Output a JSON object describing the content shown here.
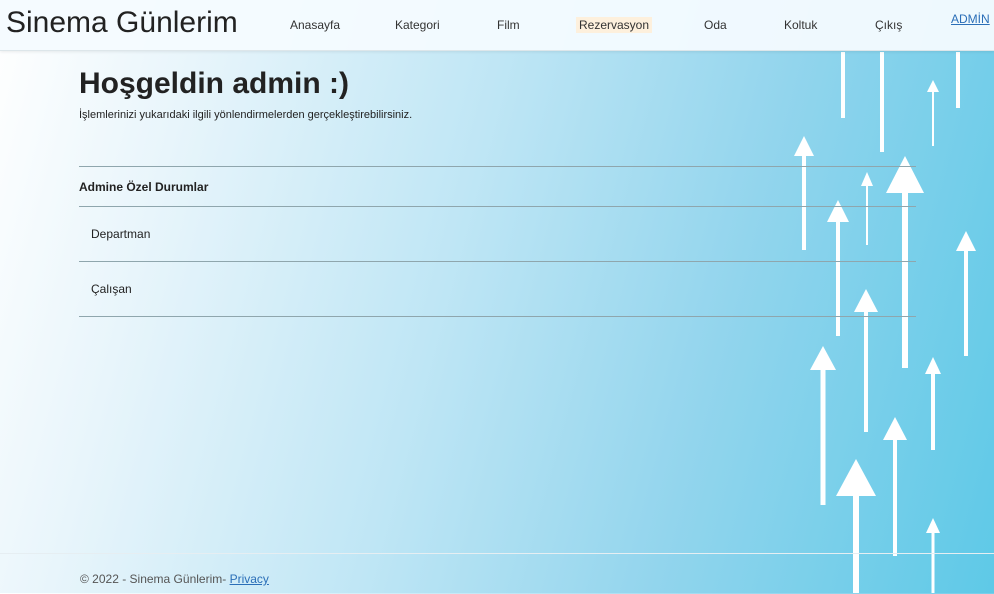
{
  "brand": "Sinema Günlerim",
  "nav": {
    "items": [
      "Anasayfa",
      "Kategori",
      "Film",
      "Rezervasyon",
      "Oda",
      "Koltuk",
      "Çıkış"
    ],
    "active": "Rezervasyon",
    "user": "ADMİN"
  },
  "main": {
    "title": "Hoşgeldin admin :)",
    "subtitle": "İşlemlerinizi yukarıdaki ilgili yönlendirmelerden gerçekleştirebilirsiniz.",
    "section_header": "Admine Özel Durumlar",
    "items": [
      "Departman",
      "Çalışan"
    ]
  },
  "footer": {
    "copyright": "© 2022 - Sinema Günlerim-",
    "privacy": "Privacy"
  },
  "colors": {
    "gradient_end": "#5ec9e7",
    "link": "#2b6fb8",
    "active_nav_bg": "#fdf0dd"
  }
}
